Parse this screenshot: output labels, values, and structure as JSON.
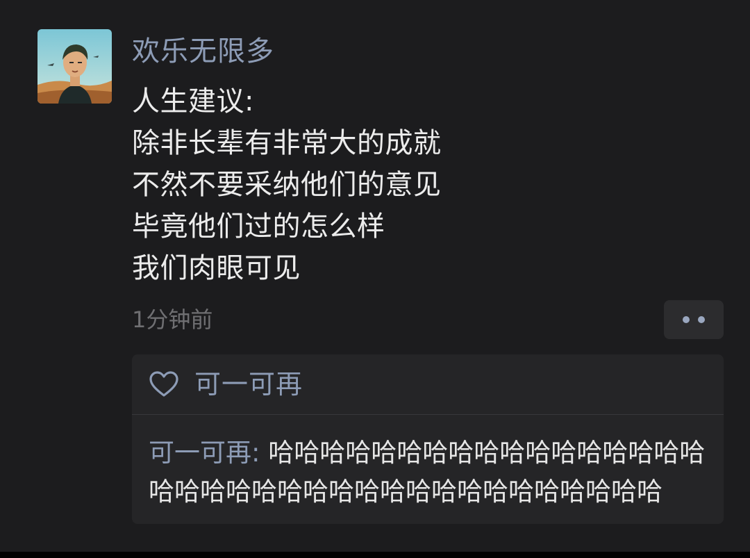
{
  "post": {
    "author": "欢乐无限多",
    "lines": [
      "人生建议:",
      "除非长辈有非常大的成就",
      "不然不要采纳他们的意见",
      "毕竟他们过的怎么样",
      "我们肉眼可见"
    ],
    "timestamp": "1分钟前"
  },
  "likes": {
    "icon": "heart-outline-icon",
    "names": "可一可再"
  },
  "comments": [
    {
      "author": "可一可再",
      "separator": ": ",
      "text": "哈哈哈哈哈哈哈哈哈哈哈哈哈哈哈哈哈哈哈哈哈哈哈哈哈哈哈哈哈哈哈哈哈哈哈哈哈"
    }
  ],
  "colors": {
    "background": "#1c1c1e",
    "link_blue": "#8d9cb6",
    "text": "#ececec",
    "muted": "#6f6f72",
    "panel": "#252527"
  }
}
